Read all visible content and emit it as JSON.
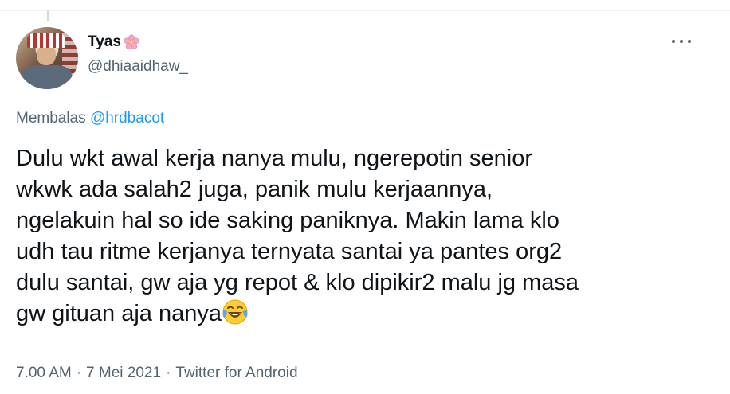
{
  "tweet": {
    "display_name": "Tyas",
    "name_emoji": "cherry-blossom-icon",
    "handle": "@dhiaaidhaw_",
    "reply_prefix": "Membalas",
    "reply_mention": "@hrdbacot",
    "text": "Dulu wkt awal kerja nanya mulu, ngerepotin senior\nwkwk ada salah2 juga, panik mulu kerjaannya,\nngelakuin hal so ide saking paniknya. Makin lama klo\nudh tau ritme kerjanya ternyata santai ya pantes org2\ndulu santai, gw aja yg repot & klo dipikir2 malu jg masa\ngw gituan aja nanya",
    "text_emoji": "face-with-tears-of-joy-icon",
    "time": "7.00 AM",
    "separator_1": "·",
    "date": "7 Mei 2021",
    "separator_2": "·",
    "source": "Twitter for Android"
  },
  "colors": {
    "primary_text": "#0f1419",
    "secondary_text": "#536471",
    "link": "#1d9bf0"
  }
}
